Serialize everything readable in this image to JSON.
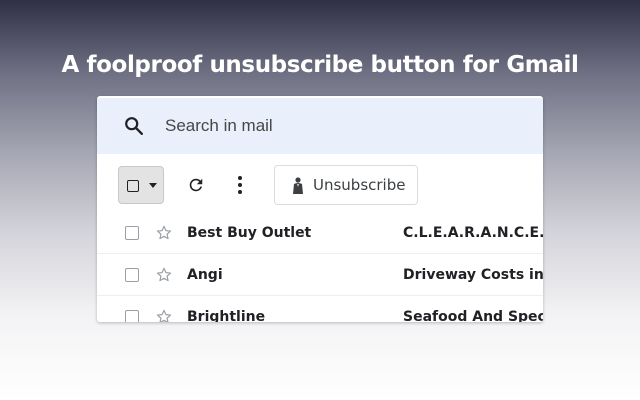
{
  "headline": "A foolproof unsubscribe button for Gmail",
  "search": {
    "placeholder": "Search in mail",
    "icon": "search-icon"
  },
  "toolbar": {
    "unsubscribe_label": "Unsubscribe",
    "icons": [
      "checkbox-icon",
      "chevron-down-icon",
      "refresh-icon",
      "more-vertical-icon",
      "person-icon"
    ]
  },
  "emails": [
    {
      "sender": "Best Buy Outlet",
      "subject": "C.L.E.A.R.A.N.C.E. C"
    },
    {
      "sender": "Angi",
      "subject": "Driveway Costs in W"
    },
    {
      "sender": "Brightline",
      "subject": "Seafood And Speci"
    }
  ],
  "colors": {
    "search_bg": "#eaf0fb",
    "text": "#202124"
  }
}
